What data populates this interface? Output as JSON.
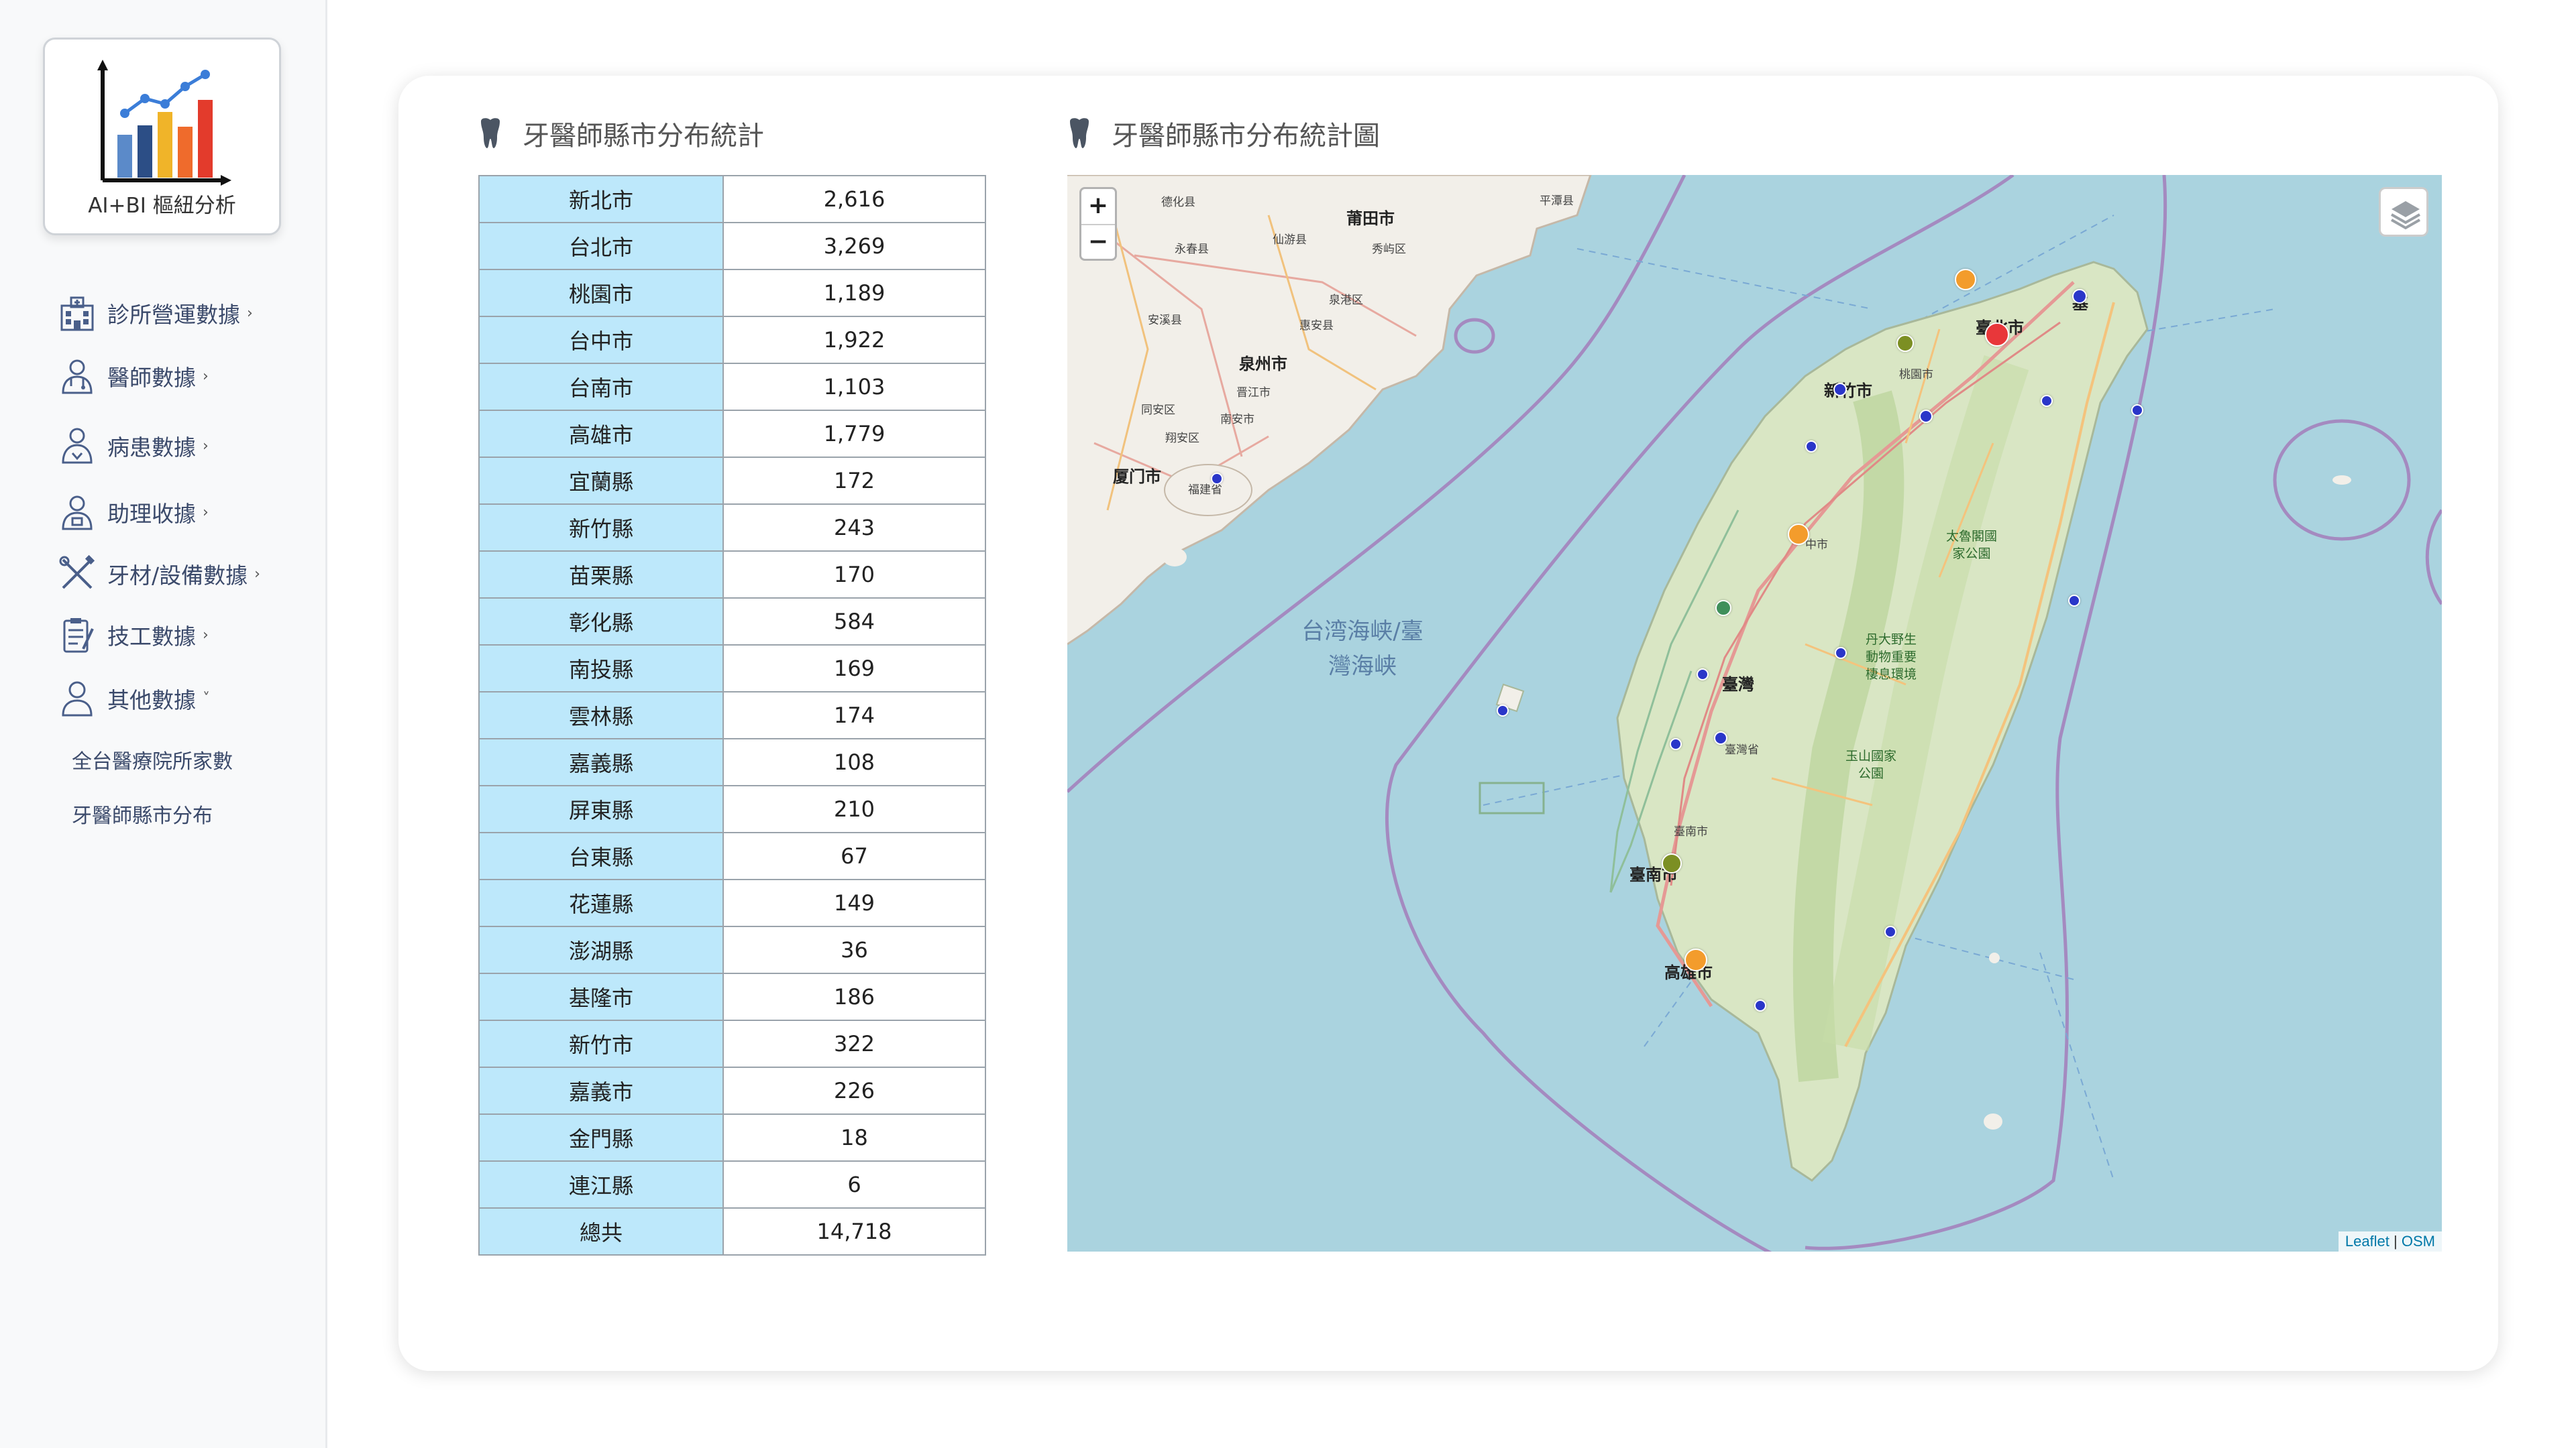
{
  "sidebar": {
    "logo_text": "AI+BI 樞紐分析",
    "nav": [
      {
        "label": "診所營運數據",
        "chevron": "›"
      },
      {
        "label": "醫師數據",
        "chevron": "›"
      },
      {
        "label": "病患數據",
        "chevron": "›"
      },
      {
        "label": "助理收據",
        "chevron": "›"
      },
      {
        "label": "牙材/設備數據",
        "chevron": "›"
      },
      {
        "label": "技工數據",
        "chevron": "›"
      },
      {
        "label": "其他數據",
        "chevron": "˅"
      }
    ],
    "sub_items": [
      "全台醫療院所家數",
      "牙醫師縣市分布"
    ]
  },
  "table_section": {
    "title": "牙醫師縣市分布統計",
    "rows": [
      {
        "name": "新北市",
        "count": "2,616"
      },
      {
        "name": "台北市",
        "count": "3,269"
      },
      {
        "name": "桃園市",
        "count": "1,189"
      },
      {
        "name": "台中市",
        "count": "1,922"
      },
      {
        "name": "台南市",
        "count": "1,103"
      },
      {
        "name": "高雄市",
        "count": "1,779"
      },
      {
        "name": "宜蘭縣",
        "count": "172"
      },
      {
        "name": "新竹縣",
        "count": "243"
      },
      {
        "name": "苗栗縣",
        "count": "170"
      },
      {
        "name": "彰化縣",
        "count": "584"
      },
      {
        "name": "南投縣",
        "count": "169"
      },
      {
        "name": "雲林縣",
        "count": "174"
      },
      {
        "name": "嘉義縣",
        "count": "108"
      },
      {
        "name": "屏東縣",
        "count": "210"
      },
      {
        "name": "台東縣",
        "count": "67"
      },
      {
        "name": "花蓮縣",
        "count": "149"
      },
      {
        "name": "澎湖縣",
        "count": "36"
      },
      {
        "name": "基隆市",
        "count": "186"
      },
      {
        "name": "新竹市",
        "count": "322"
      },
      {
        "name": "嘉義市",
        "count": "226"
      },
      {
        "name": "金門縣",
        "count": "18"
      },
      {
        "name": "連江縣",
        "count": "6"
      },
      {
        "name": "總共",
        "count": "14,718"
      }
    ]
  },
  "map_section": {
    "title": "牙醫師縣市分布統計圖",
    "zoom_in": "+",
    "zoom_out": "−",
    "attribution": {
      "leaflet": "Leaflet",
      "sep": "|",
      "osm": "OSM"
    },
    "sea_label": "台湾海峡/臺\n灣海峡",
    "labels": {
      "taipei": "臺北市",
      "keelung": "基",
      "hsinchu": "新竹市",
      "taoyuan": "桃園市",
      "taichung": "中市",
      "taiwan": "臺灣",
      "taiwan_prov": "臺灣省",
      "tainan": "臺南市",
      "tainan2": "臺南市",
      "kaohsiung": "高雄市",
      "xiamen": "厦门市",
      "quanzhou": "泉州市",
      "jinjiang": "晋江市",
      "putian": "莆田市",
      "fujian": "福建省",
      "anxi": "安溪县",
      "nanan": "南安市",
      "tongan": "同安区",
      "xiangan": "翔安区",
      "huian": "惠安县",
      "quangang": "泉港区",
      "xianyou": "仙游县",
      "yongchun": "永春县",
      "dehua": "德化县",
      "xiuyu": "秀屿区",
      "pingtan": "平潭县"
    },
    "parks": {
      "taroko": "太魯閣國\n家公園",
      "danda": "丹大野生\n動物重要\n棲息環境",
      "yushan": "玉山國家\n公園"
    },
    "marker_colors": {
      "red": "#e8373a",
      "orange": "#f39c2c",
      "olive": "#7c8f23",
      "green": "#3f8f5a",
      "blue": "#2a36c9"
    }
  }
}
